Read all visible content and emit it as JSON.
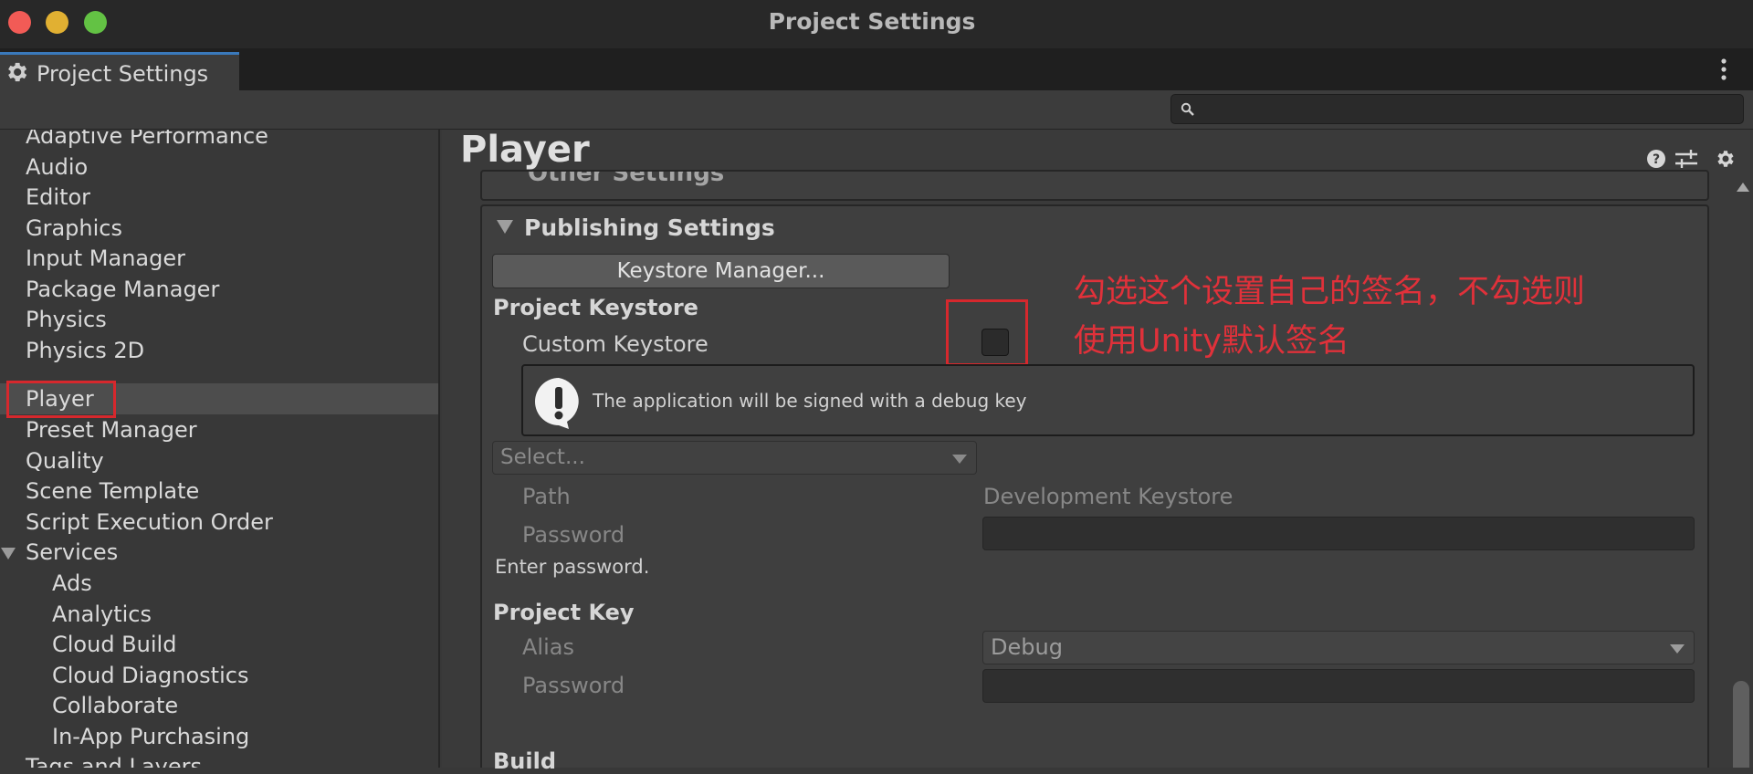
{
  "window": {
    "title": "Project Settings"
  },
  "tab": {
    "label": "Project Settings",
    "icon": "gear-icon"
  },
  "search": {
    "placeholder": "",
    "icon": "search-icon"
  },
  "sidebar": {
    "items": [
      {
        "label": "Adaptive Performance"
      },
      {
        "label": "Audio"
      },
      {
        "label": "Editor"
      },
      {
        "label": "Graphics"
      },
      {
        "label": "Input Manager"
      },
      {
        "label": "Package Manager"
      },
      {
        "label": "Physics"
      },
      {
        "label": "Physics 2D"
      },
      {
        "label": "Player",
        "selected": true
      },
      {
        "label": "Preset Manager"
      },
      {
        "label": "Quality"
      },
      {
        "label": "Scene Template"
      },
      {
        "label": "Script Execution Order"
      },
      {
        "label": "Services",
        "expanded": true
      },
      {
        "label": "Ads"
      },
      {
        "label": "Analytics"
      },
      {
        "label": "Cloud Build"
      },
      {
        "label": "Cloud Diagnostics"
      },
      {
        "label": "Collaborate"
      },
      {
        "label": "In-App Purchasing"
      },
      {
        "label": "Tags and Layers"
      }
    ]
  },
  "main": {
    "title": "Player",
    "header_icons": [
      "help-icon",
      "presets-icon",
      "settings-icon"
    ],
    "other_settings": {
      "label": "Other Settings"
    },
    "publishing": {
      "title": "Publishing Settings",
      "keystore_manager_button": "Keystore Manager...",
      "project_keystore_heading": "Project Keystore",
      "custom_keystore_label": "Custom Keystore",
      "custom_keystore_checked": false,
      "info_message": "The application will be signed with a debug key",
      "select_placeholder": "Select...",
      "path_label": "Path",
      "path_value": "Development Keystore",
      "password_label": "Password",
      "password_hint": "Enter password.",
      "project_key_heading": "Project Key",
      "alias_label": "Alias",
      "alias_value": "Debug",
      "key_password_label": "Password",
      "build_heading": "Build"
    }
  },
  "annotation": {
    "line1": "勾选这个设置自己的签名，不勾选则",
    "line2": "使用Unity默认签名",
    "color": "#e0313a"
  },
  "colors": {
    "window_bg": "#383838",
    "titlebar_bg": "#282828",
    "accent": "#3a79bb",
    "highlight_red": "#d6282d"
  }
}
